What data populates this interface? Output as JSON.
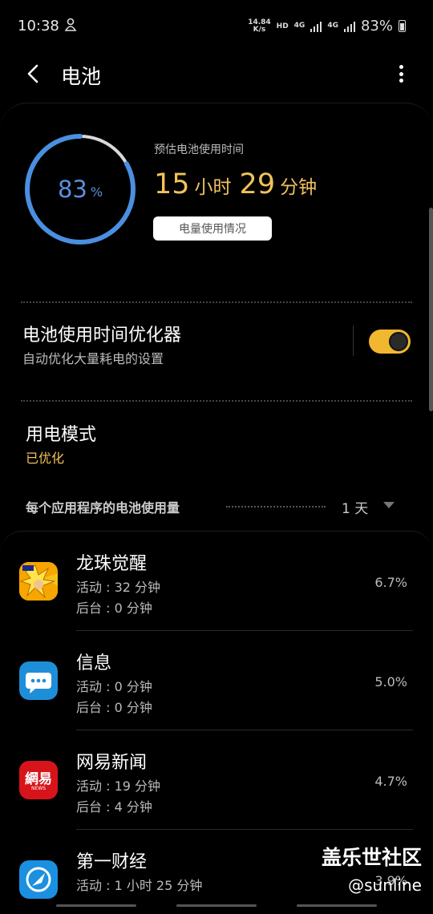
{
  "status_bar": {
    "time": "10:38",
    "net_speed_value": "14.84",
    "net_speed_unit": "K/s",
    "hd": "HD",
    "network1": "4G",
    "network2": "4G",
    "battery": "83%"
  },
  "header": {
    "title": "电池",
    "back_icon": "chevron-left-icon",
    "more_icon": "more-vertical-icon"
  },
  "battery": {
    "percent_number": "83",
    "percent_unit": "%",
    "level_fraction": 0.83,
    "estimate_label": "预估电池使用时间",
    "hours": "15",
    "hours_unit": "小时",
    "minutes": "29",
    "minutes_unit": "分钟",
    "usage_button": "电量使用情况",
    "ring_color": "#4a8fe0",
    "accent_color": "#f0c25a"
  },
  "optimizer": {
    "title": "电池使用时间优化器",
    "subtitle": "自动优化大量耗电的设置",
    "enabled": true
  },
  "power_mode": {
    "title": "用电模式",
    "value": "已优化"
  },
  "per_app": {
    "label": "每个应用程序的电池使用量",
    "period": "1 天"
  },
  "apps": [
    {
      "name": "龙珠觉醒",
      "active": "活动 : 32 分钟",
      "background": "后台 : 0 分钟",
      "percent": "6.7%",
      "icon": "dragon-ball-app-icon"
    },
    {
      "name": "信息",
      "active": "活动 : 0 分钟",
      "background": "后台 : 0 分钟",
      "percent": "5.0%",
      "icon": "messages-app-icon"
    },
    {
      "name": "网易新闻",
      "active": "活动 : 19 分钟",
      "background": "后台 : 4 分钟",
      "percent": "4.7%",
      "icon": "netease-news-app-icon",
      "icon_text": "網易",
      "icon_subtext": "NEWS"
    },
    {
      "name": "第一财经",
      "active": "活动 : 1 小时 25 分钟",
      "background": "",
      "percent": "3.9%",
      "icon": "yicai-app-icon"
    }
  ],
  "watermark": {
    "title": "盖乐世社区",
    "user": "@sunline"
  }
}
